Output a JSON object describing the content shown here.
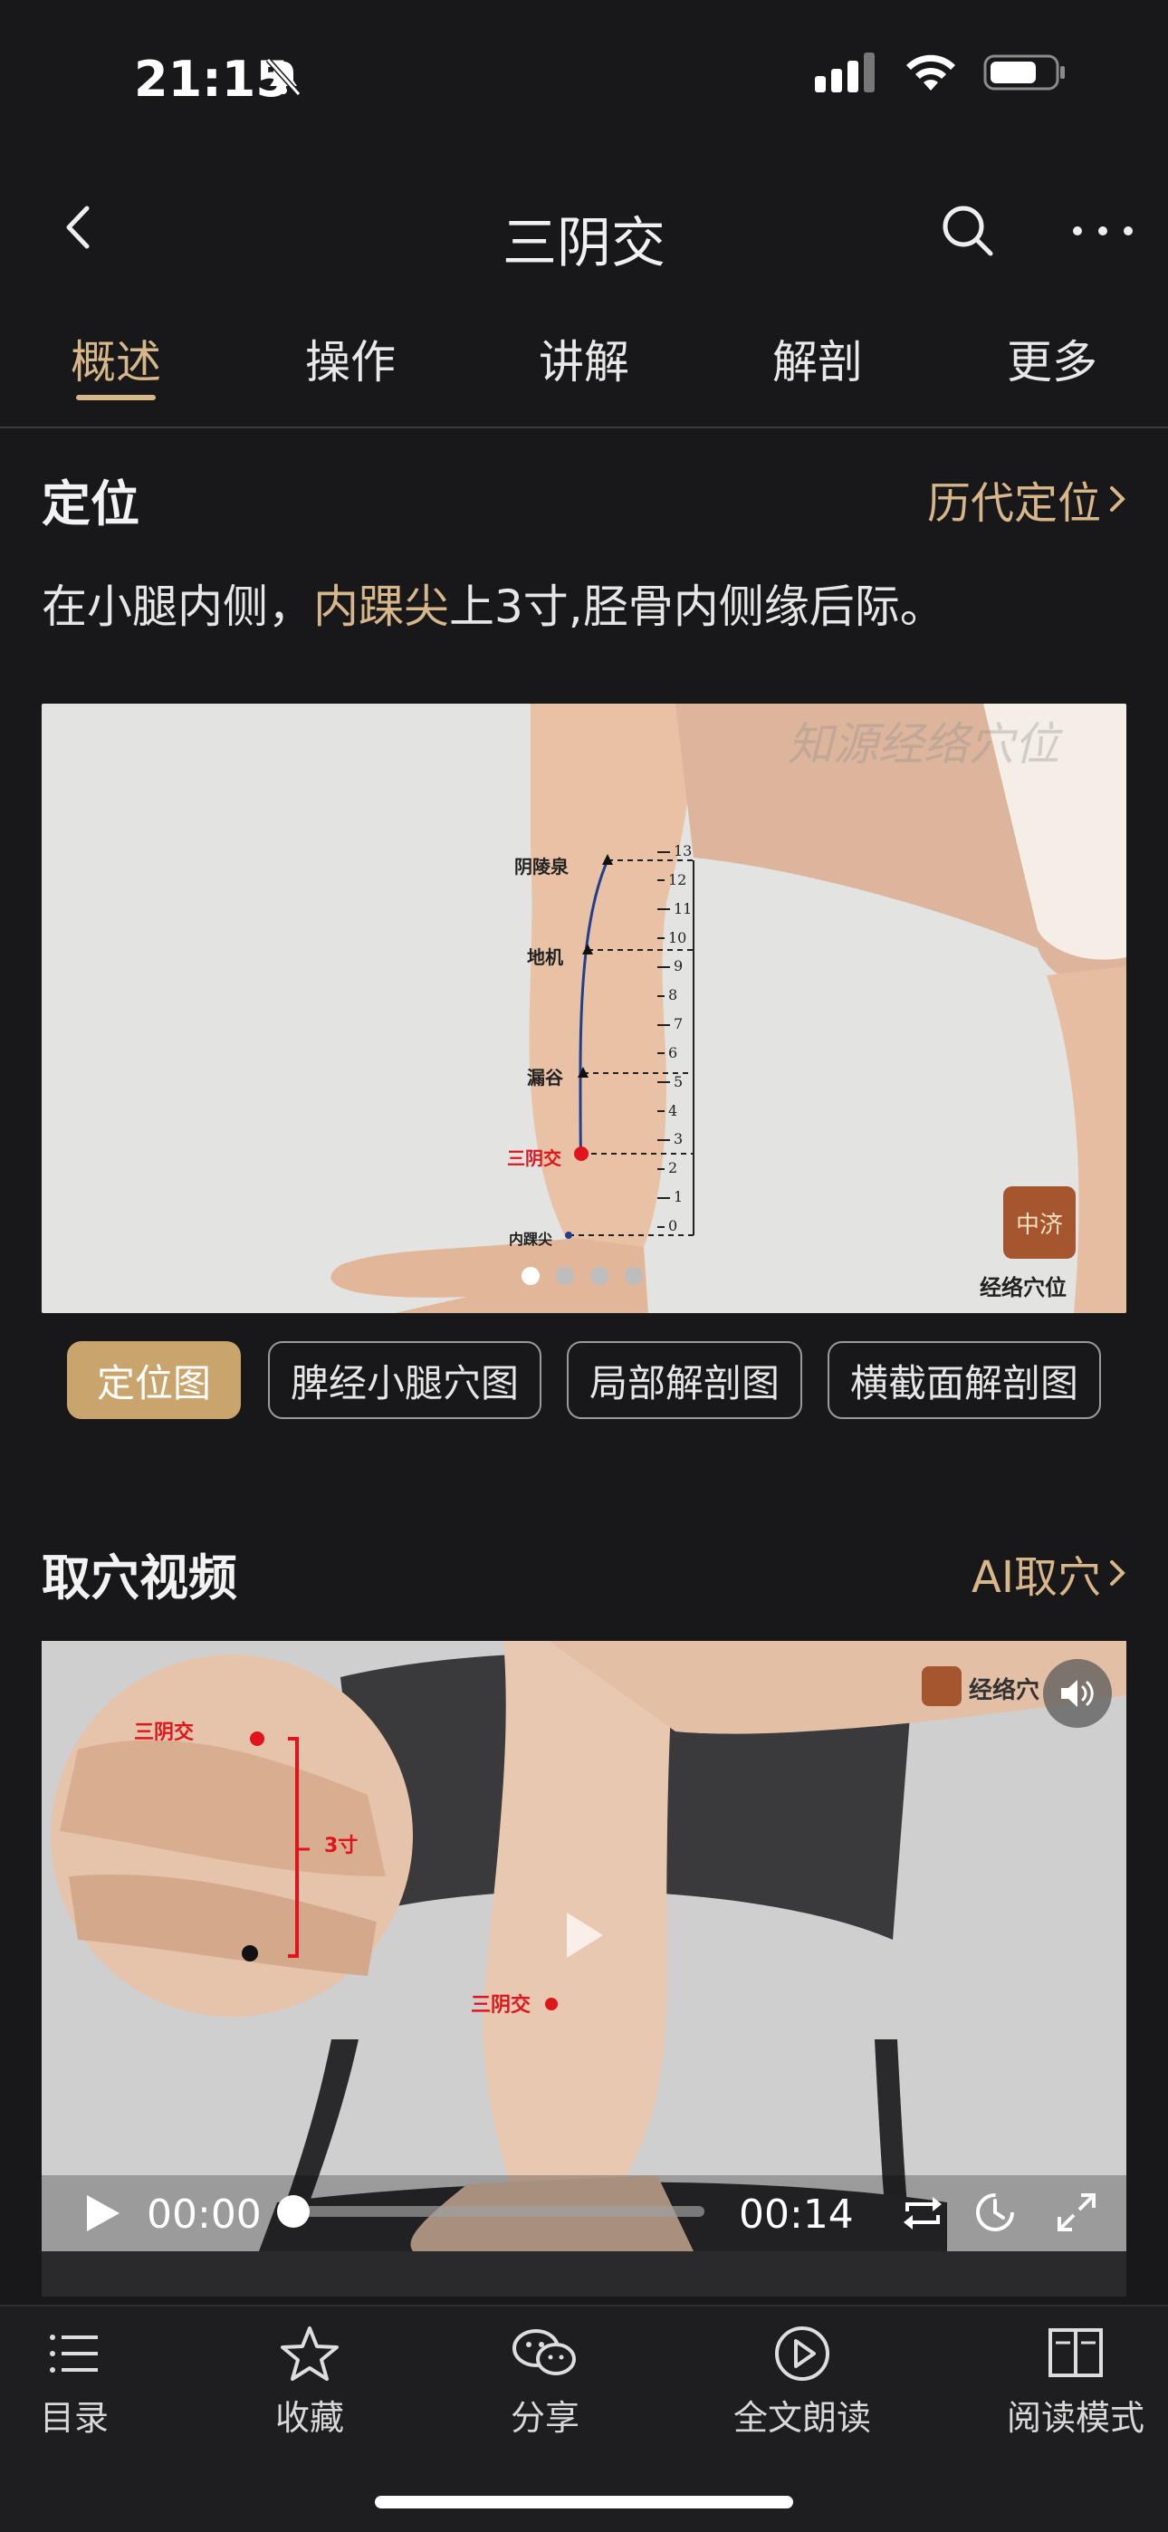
{
  "status": {
    "time": "21:15"
  },
  "nav": {
    "title": "三阴交"
  },
  "tabs": [
    "概述",
    "操作",
    "讲解",
    "解剖",
    "更多"
  ],
  "location": {
    "title": "定位",
    "link": "历代定位",
    "desc_pre": "在小腿内侧，",
    "desc_hl": "内踝尖",
    "desc_post": "上3寸,胫骨内侧缘后际。"
  },
  "figure": {
    "watermark": "知源经络穴位",
    "points": [
      "阴陵泉",
      "地机",
      "漏谷",
      "三阴交",
      "内踝尖"
    ],
    "ruler_ticks": [
      "13",
      "12",
      "11",
      "10",
      "9",
      "8",
      "7",
      "6",
      "5",
      "4",
      "3",
      "2",
      "1",
      "0"
    ],
    "logo_seal": "中济",
    "logo_text": "经络穴位",
    "page_dots": 4,
    "page_active": 1
  },
  "chips": [
    "定位图",
    "脾经小腿穴图",
    "局部解剖图",
    "横截面解剖图"
  ],
  "video": {
    "title": "取穴视频",
    "link": "AI取穴",
    "inset_label": "三阴交",
    "inset_measure": "3寸",
    "leg_label": "三阴交",
    "logo_text": "经络穴",
    "current_time": "00:00",
    "duration": "00:14",
    "progress": 0
  },
  "bottom": [
    {
      "label": "目录",
      "icon": "list-icon"
    },
    {
      "label": "收藏",
      "icon": "star-icon"
    },
    {
      "label": "分享",
      "icon": "wechat-icon"
    },
    {
      "label": "全文朗读",
      "icon": "play-circle-icon"
    },
    {
      "label": "阅读模式",
      "icon": "book-icon"
    }
  ],
  "colors": {
    "accent": "#d7b78a",
    "chip_active": "#c9a46d",
    "background": "#18181b",
    "point_red": "#e0141c"
  }
}
